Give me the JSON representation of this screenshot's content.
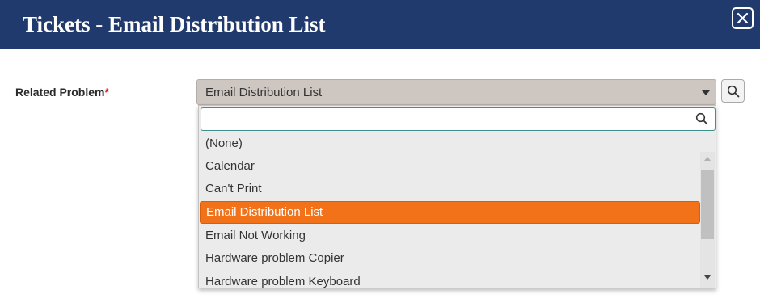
{
  "dialog": {
    "title": "Tickets - Email Distribution List",
    "close_icon": "close-icon"
  },
  "field": {
    "label": "Related Problem",
    "required_marker": "*",
    "selected_value": "Email Distribution List",
    "lookup_icon": "search-icon"
  },
  "dropdown": {
    "search_value": "",
    "search_icon": "search-icon",
    "options": [
      "(None)",
      "Calendar",
      "Can't Print",
      "Email Distribution List",
      "Email Not Working",
      "Hardware problem Copier",
      "Hardware problem Keyboard"
    ],
    "highlighted_option": "Email Distribution List"
  },
  "colors": {
    "header_bg": "#213a6e",
    "highlight": "#f2721a",
    "required": "#d81e1e",
    "select_bg": "#cdc6c1",
    "search_border": "#3f8f8f"
  }
}
